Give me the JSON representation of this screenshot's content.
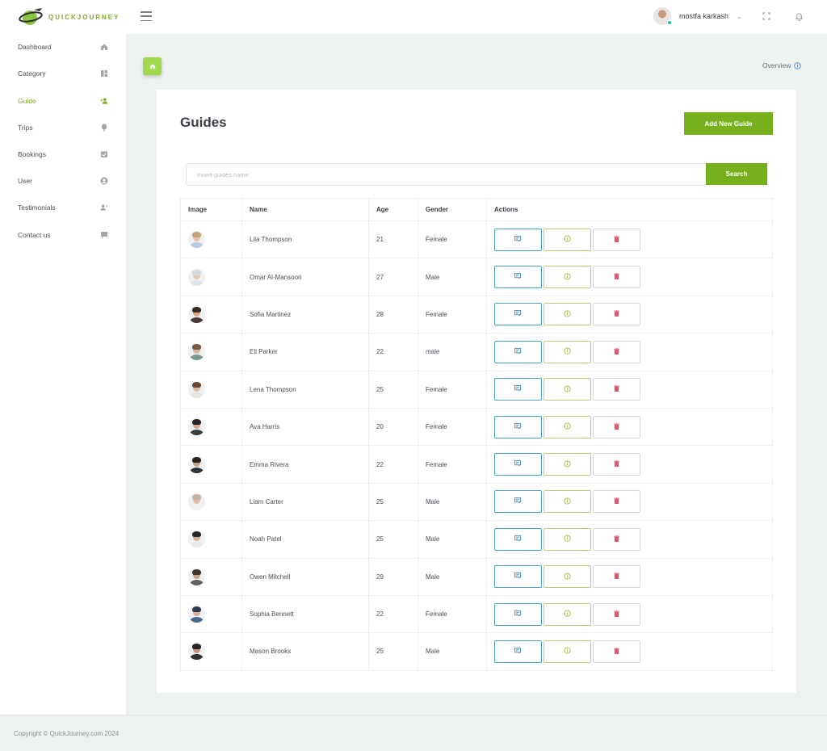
{
  "header": {
    "brand": "QUICKJOURNEY",
    "user_name": "mostfa karkash"
  },
  "sidebar": {
    "items": [
      {
        "label": "Dashboard",
        "icon": "home-icon",
        "active": false
      },
      {
        "label": "Category",
        "icon": "grid-icon",
        "active": false
      },
      {
        "label": "Guide",
        "icon": "person-add-icon",
        "active": true
      },
      {
        "label": "Trips",
        "icon": "balloon-icon",
        "active": false
      },
      {
        "label": "Bookings",
        "icon": "calendar-check-icon",
        "active": false
      },
      {
        "label": "User",
        "icon": "user-circle-icon",
        "active": false
      },
      {
        "label": "Testimonials",
        "icon": "user-voice-icon",
        "active": false
      },
      {
        "label": "Contact us",
        "icon": "chat-icon",
        "active": false
      }
    ]
  },
  "main": {
    "overview_label": "Overview",
    "title": "Guides",
    "add_button": "Add New Guide",
    "search_placeholder": "Insert guides name",
    "search_button": "Search",
    "columns": [
      "Image",
      "Name",
      "Age",
      "Gender",
      "Actions"
    ],
    "rows": [
      {
        "name": "Lila Thompson",
        "age": "21",
        "gender": "Female"
      },
      {
        "name": "Omar Al-Mansoori",
        "age": "27",
        "gender": "Male"
      },
      {
        "name": "Sofia Martinez",
        "age": "28",
        "gender": "Female"
      },
      {
        "name": "Eli Parker",
        "age": "22",
        "gender": "male"
      },
      {
        "name": "Lena Thompson",
        "age": "25",
        "gender": "Female"
      },
      {
        "name": "Ava Harris",
        "age": "20",
        "gender": "Female"
      },
      {
        "name": "Emma Rivera",
        "age": "22",
        "gender": "Female"
      },
      {
        "name": "Liam Carter",
        "age": "25",
        "gender": "Male"
      },
      {
        "name": "Noah Patel",
        "age": "25",
        "gender": "Male"
      },
      {
        "name": "Owen Mitchell",
        "age": "29",
        "gender": "Male"
      },
      {
        "name": "Sophia Bennett",
        "age": "22",
        "gender": "Female"
      },
      {
        "name": "Mason Brooks",
        "age": "25",
        "gender": "Male"
      }
    ]
  },
  "footer": {
    "copyright": "Copyright © QuickJourney.com 2024"
  },
  "colors": {
    "accent": "#76b01d",
    "edit": "#4aa3c4",
    "info": "#9bb83a",
    "delete": "#e0566f"
  }
}
